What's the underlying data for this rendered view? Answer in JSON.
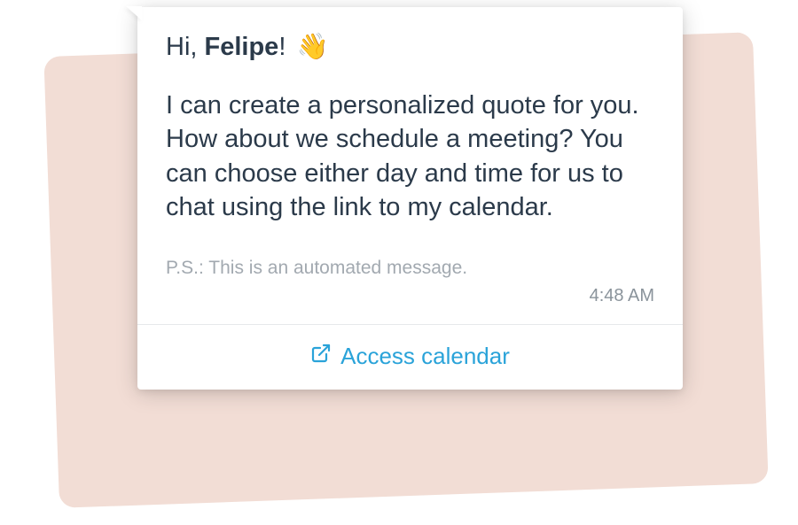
{
  "message": {
    "greeting_prefix": "Hi, ",
    "greeting_name": "Felipe",
    "greeting_suffix": "! ",
    "wave_emoji": "👋",
    "body": "I can create a personalized quote for you. How about we schedule a meeting? You can choose either day and time for us to chat using the link to my calendar.",
    "ps": "P.S.: This is an automated message.",
    "timestamp": "4:48 AM"
  },
  "action": {
    "label": "Access calendar"
  }
}
